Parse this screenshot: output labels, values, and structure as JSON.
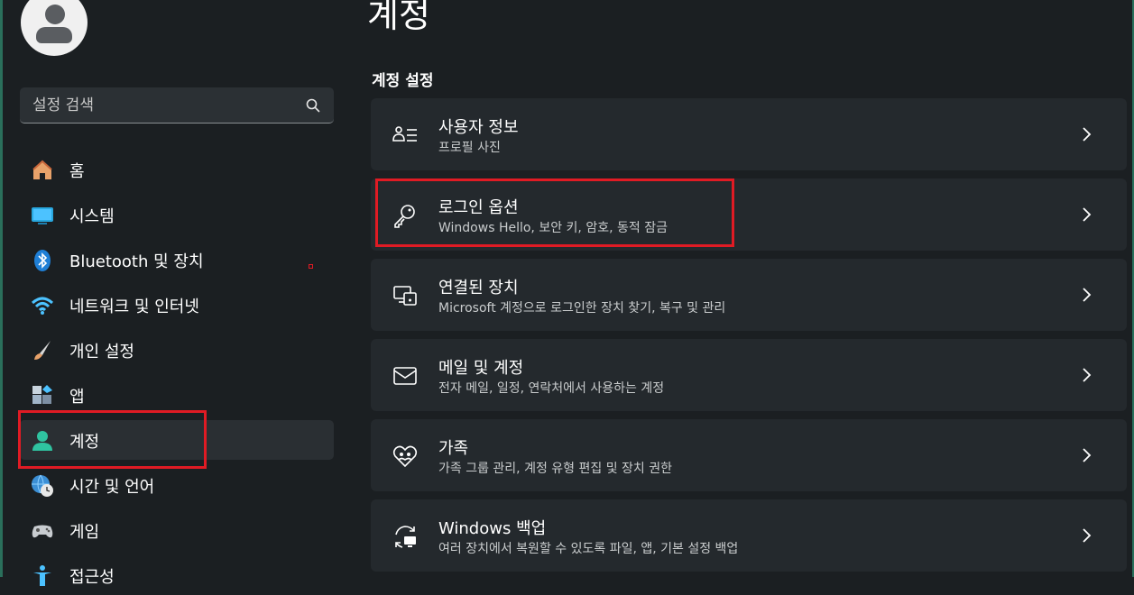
{
  "page": {
    "title": "계정"
  },
  "sidebar": {
    "search_placeholder": "설정 검색",
    "items": [
      {
        "label": "홈",
        "icon": "home-icon"
      },
      {
        "label": "시스템",
        "icon": "system-icon"
      },
      {
        "label": "Bluetooth 및 장치",
        "icon": "bluetooth-icon"
      },
      {
        "label": "네트워크 및 인터넷",
        "icon": "wifi-icon"
      },
      {
        "label": "개인 설정",
        "icon": "brush-icon"
      },
      {
        "label": "앱",
        "icon": "apps-icon"
      },
      {
        "label": "계정",
        "icon": "account-icon",
        "active": true
      },
      {
        "label": "시간 및 언어",
        "icon": "clock-globe-icon"
      },
      {
        "label": "게임",
        "icon": "gamepad-icon"
      },
      {
        "label": "접근성",
        "icon": "accessibility-icon"
      }
    ]
  },
  "main": {
    "section_title": "계정 설정",
    "cards": [
      {
        "title": "사용자 정보",
        "subtitle": "프로필 사진",
        "icon": "user-info-icon"
      },
      {
        "title": "로그인 옵션",
        "subtitle": "Windows Hello, 보안 키, 암호, 동적 잠금",
        "icon": "key-icon"
      },
      {
        "title": "연결된 장치",
        "subtitle": "Microsoft 계정으로 로그인한 장치 찾기, 복구 및 관리",
        "icon": "connected-devices-icon"
      },
      {
        "title": "메일 및 계정",
        "subtitle": "전자 메일, 일정, 연락처에서 사용하는 계정",
        "icon": "mail-icon"
      },
      {
        "title": "가족",
        "subtitle": "가족 그룹 관리, 계정 유형 편집 및 장치 권한",
        "icon": "family-heart-icon"
      },
      {
        "title": "Windows 백업",
        "subtitle": "여러 장치에서 복원할 수 있도록 파일, 앱, 기본 설정 백업",
        "icon": "backup-icon"
      }
    ]
  },
  "colors": {
    "background": "#1b1f22",
    "card": "#24292d",
    "highlight": "#e01b24",
    "accent": "#4cc2ff"
  }
}
